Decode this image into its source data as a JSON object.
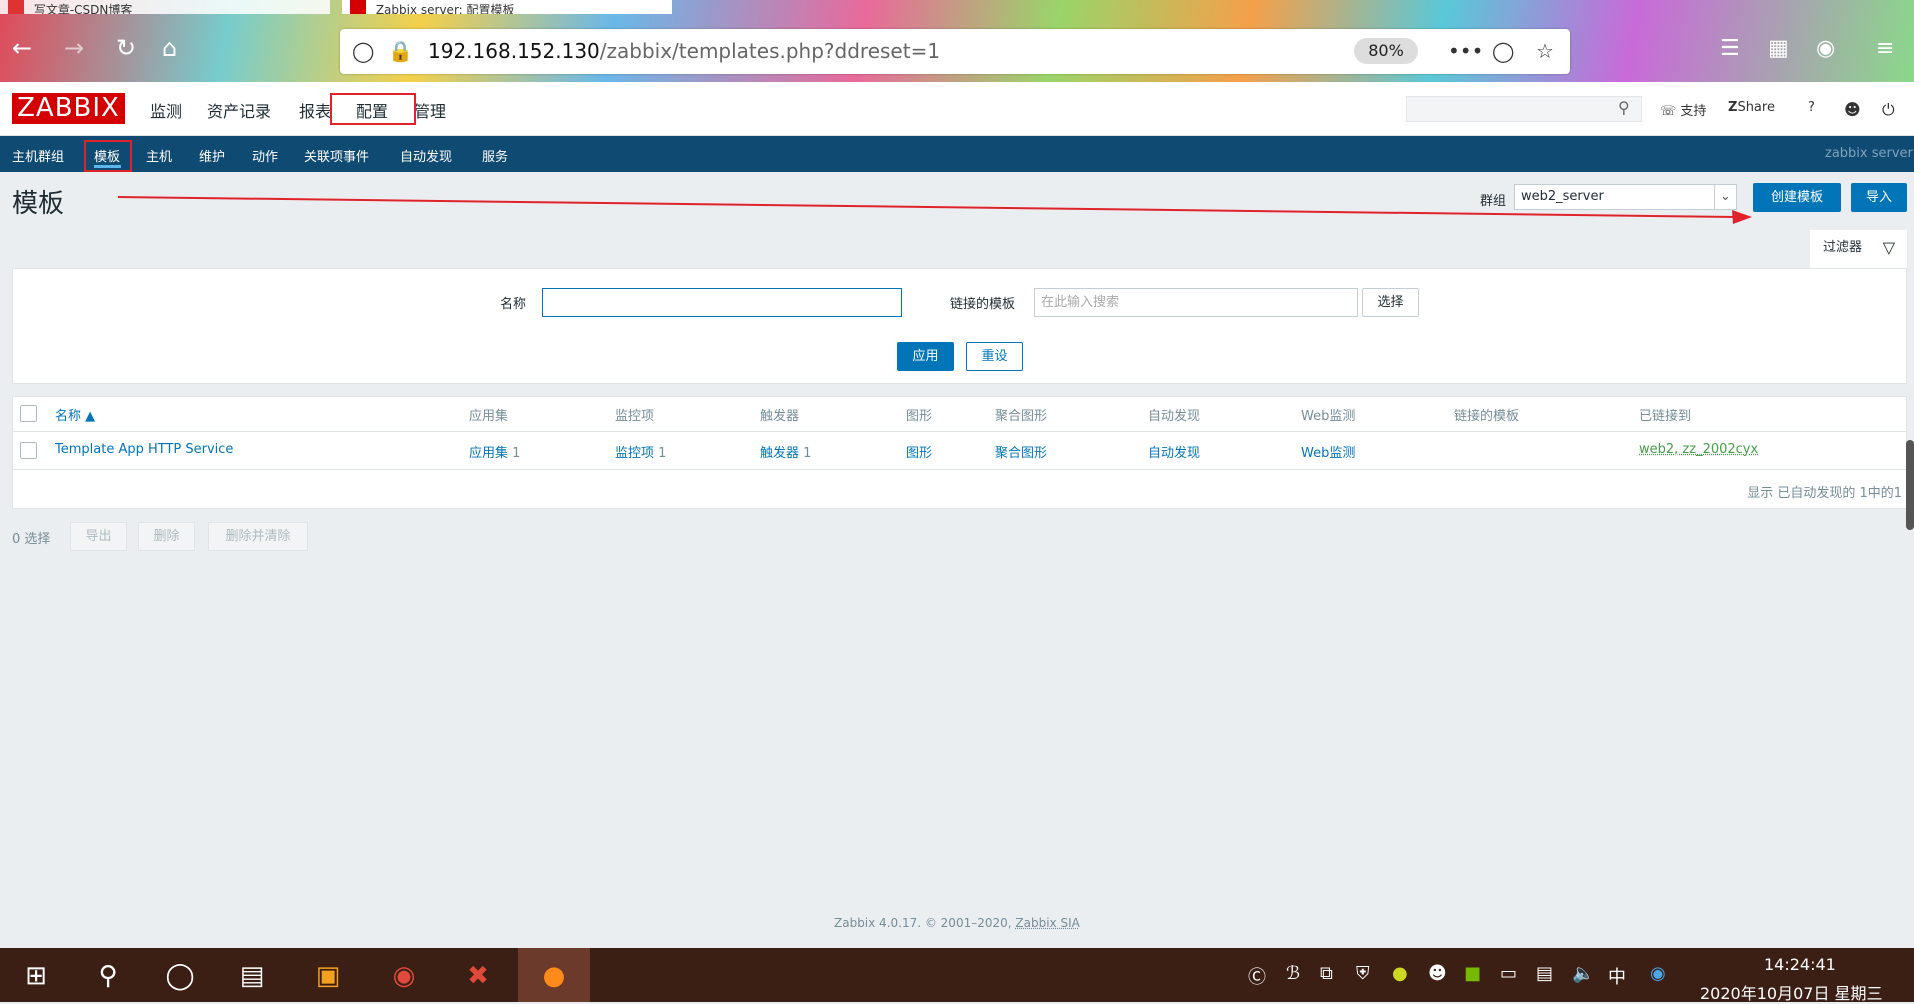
{
  "browser": {
    "tab1_title": "写文章-CSDN博客",
    "tab2_title": "Zabbix server: 配置模板",
    "url_host": "192.168.152.130",
    "url_path": "/zabbix/templates.php?ddreset=1",
    "zoom": "80%"
  },
  "header": {
    "logo": "ZABBIX",
    "nav": [
      "监测",
      "资产记录",
      "报表",
      "配置",
      "管理"
    ],
    "support": "支持",
    "share": "Share",
    "help": "?"
  },
  "subnav": {
    "items": [
      "主机群组",
      "模板",
      "主机",
      "维护",
      "动作",
      "关联项事件",
      "自动发现",
      "服务"
    ],
    "server": "zabbix server"
  },
  "page": {
    "title": "模板",
    "group_label": "群组",
    "group_value": "web2_server",
    "create_button": "创建模板",
    "import_button": "导入"
  },
  "filter": {
    "tab_label": "过滤器",
    "name_label": "名称",
    "name_value": "",
    "linked_label": "链接的模板",
    "linked_placeholder": "在此输入搜索",
    "select_button": "选择",
    "apply_button": "应用",
    "reset_button": "重设"
  },
  "table": {
    "headers": [
      "名称 ▲",
      "应用集",
      "监控项",
      "触发器",
      "图形",
      "聚合图形",
      "自动发现",
      "Web监测",
      "链接的模板",
      "已链接到"
    ],
    "rows": [
      {
        "name": "Template App HTTP Service",
        "applications": "应用集",
        "applications_count": "1",
        "items": "监控项",
        "items_count": "1",
        "triggers": "触发器",
        "triggers_count": "1",
        "graphs": "图形",
        "screens": "聚合图形",
        "discovery": "自动发现",
        "web": "Web监测",
        "linked_templates": "",
        "linked_to": "web2, zz_2002cyx"
      }
    ],
    "footer": "显示 已自动发现的 1中的1"
  },
  "actions": {
    "selected": "0 选择",
    "export": "导出",
    "delete": "删除",
    "delete_clear": "删除并清除"
  },
  "footer": {
    "text": "Zabbix 4.0.17. © 2001–2020, ",
    "link": "Zabbix SIA"
  },
  "taskbar": {
    "time": "14:24:41",
    "date": "2020年10月07日 星期三",
    "ime": "中"
  }
}
